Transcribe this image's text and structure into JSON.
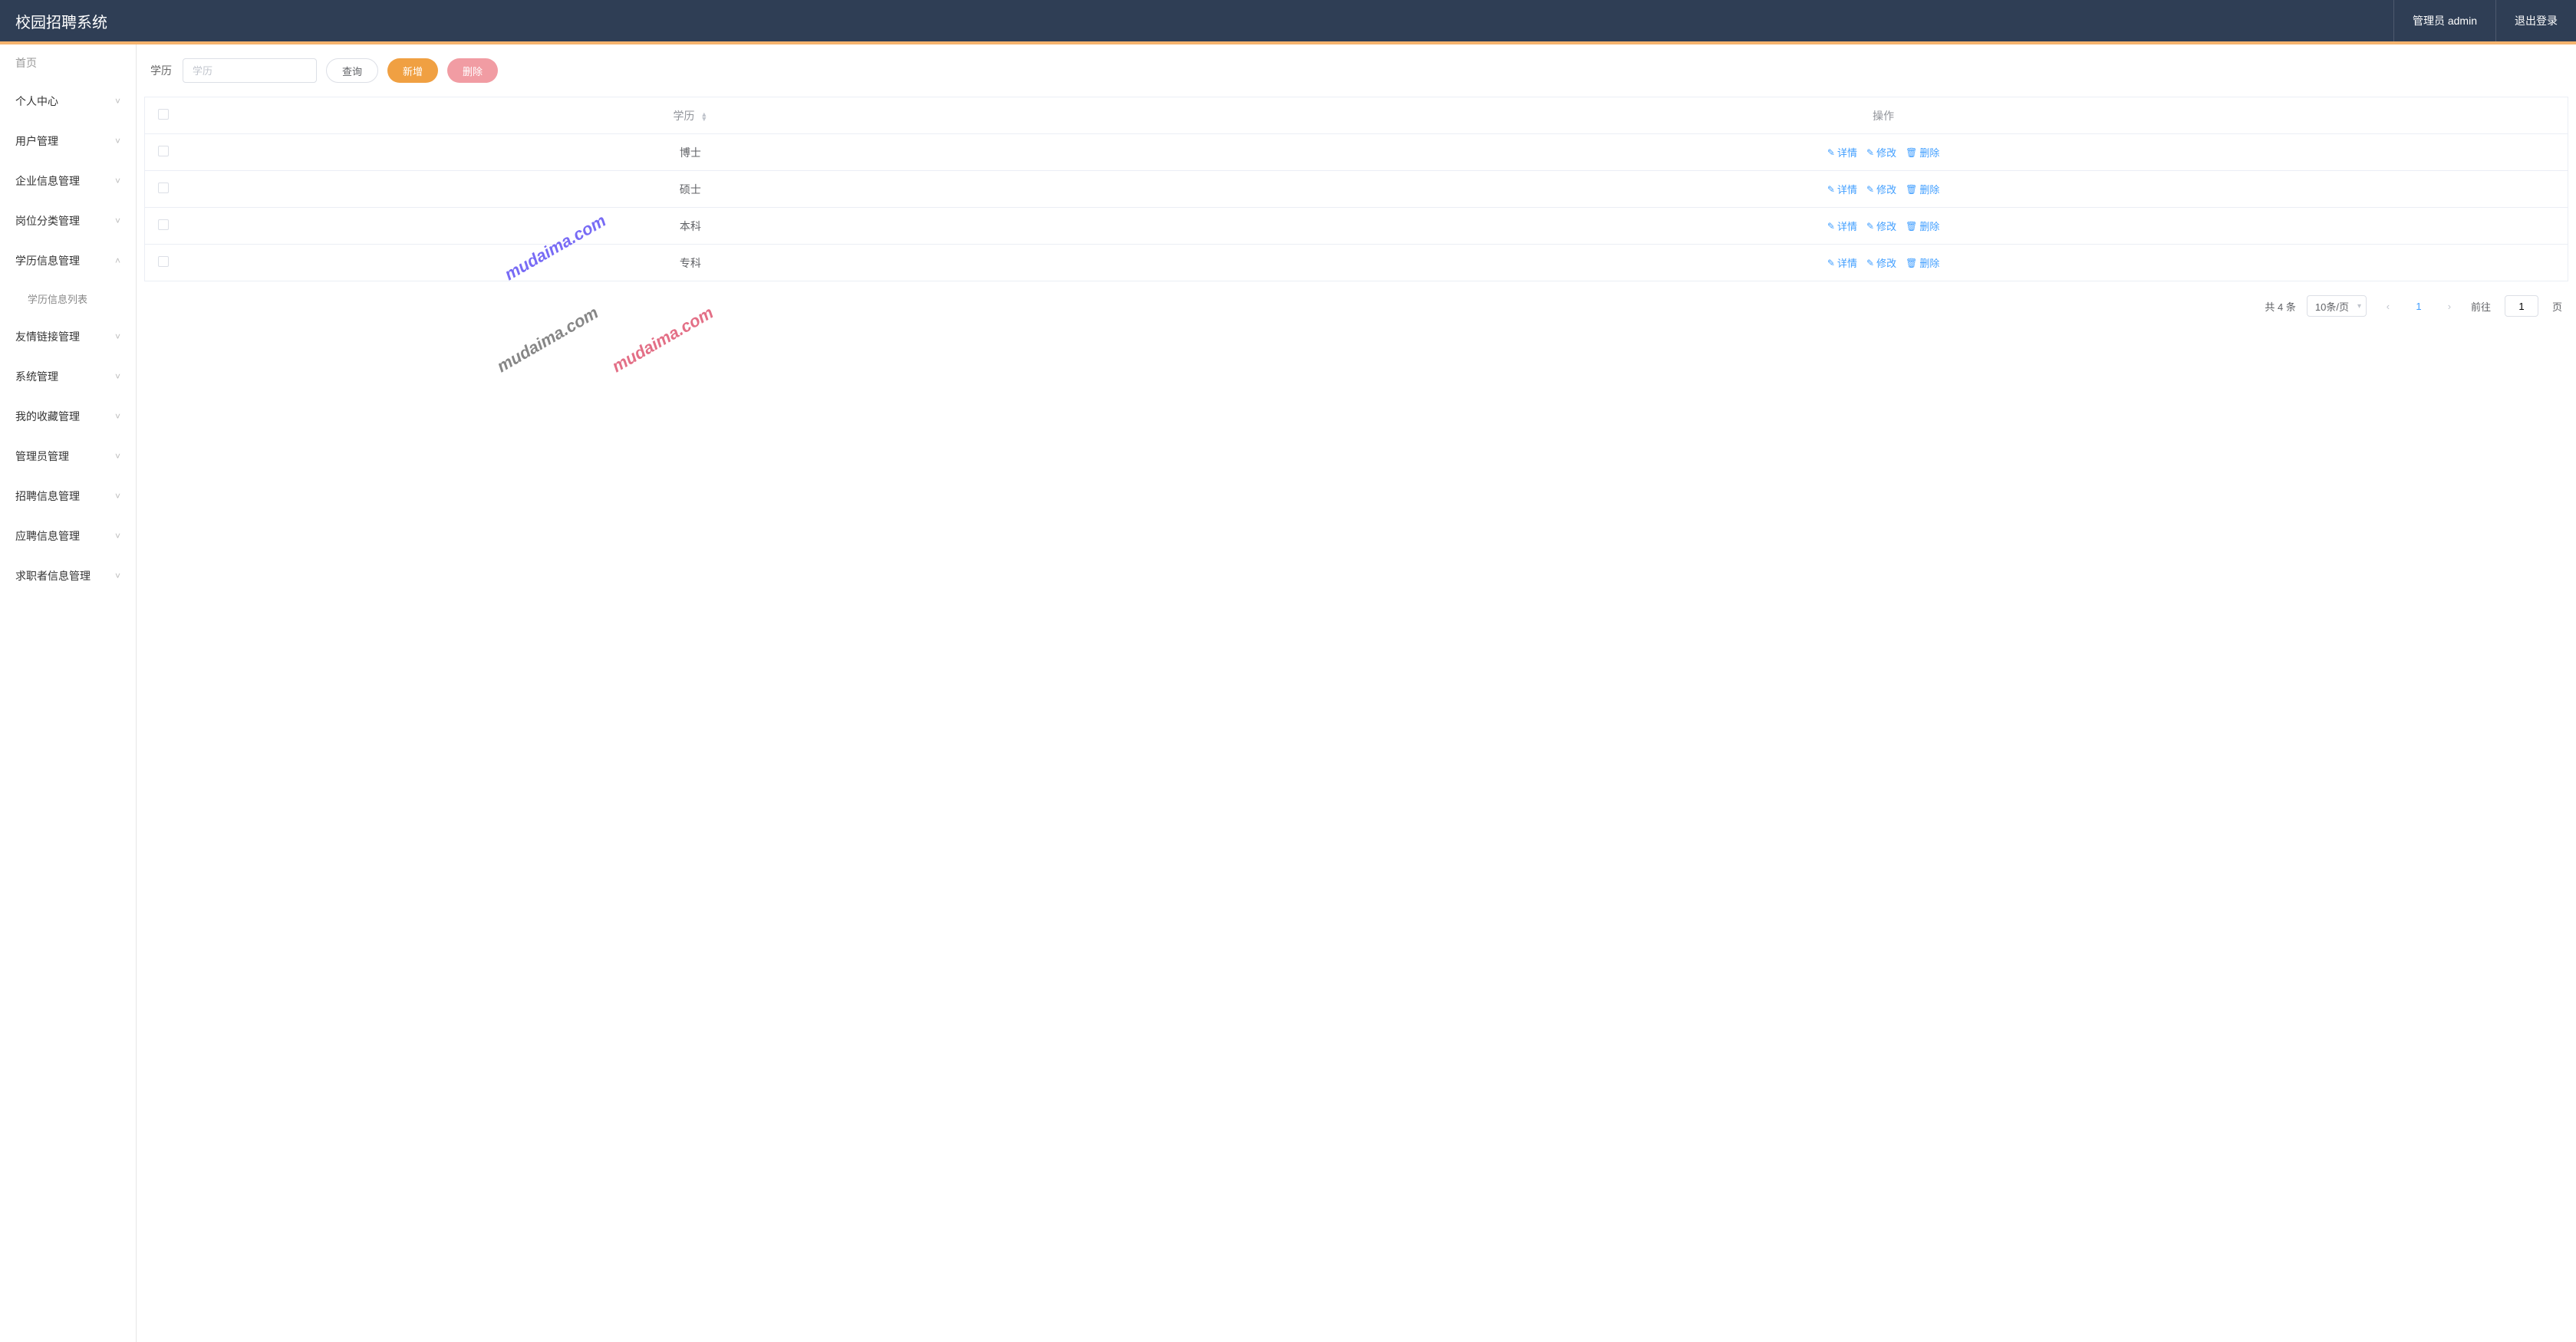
{
  "header": {
    "title": "校园招聘系统",
    "admin_label": "管理员 admin",
    "logout_label": "退出登录"
  },
  "sidebar": {
    "home": "首页",
    "items": [
      {
        "label": "个人中心",
        "expanded": false
      },
      {
        "label": "用户管理",
        "expanded": false
      },
      {
        "label": "企业信息管理",
        "expanded": false
      },
      {
        "label": "岗位分类管理",
        "expanded": false
      },
      {
        "label": "学历信息管理",
        "expanded": true,
        "sub": [
          {
            "label": "学历信息列表"
          }
        ]
      },
      {
        "label": "友情链接管理",
        "expanded": false
      },
      {
        "label": "系统管理",
        "expanded": false
      },
      {
        "label": "我的收藏管理",
        "expanded": false
      },
      {
        "label": "管理员管理",
        "expanded": false
      },
      {
        "label": "招聘信息管理",
        "expanded": false
      },
      {
        "label": "应聘信息管理",
        "expanded": false
      },
      {
        "label": "求职者信息管理",
        "expanded": false
      }
    ]
  },
  "filter": {
    "label": "学历",
    "placeholder": "学历",
    "value": "",
    "query_btn": "查询",
    "add_btn": "新增",
    "delete_btn": "删除"
  },
  "table": {
    "cols": {
      "xl": "学历",
      "ops": "操作"
    },
    "actions": {
      "detail": "详情",
      "edit": "修改",
      "delete": "删除"
    },
    "rows": [
      {
        "xl": "博士"
      },
      {
        "xl": "硕士"
      },
      {
        "xl": "本科"
      },
      {
        "xl": "专科"
      }
    ]
  },
  "pagination": {
    "total_text": "共 4 条",
    "page_size_label": "10条/页",
    "current_page": "1",
    "goto_prefix": "前往",
    "goto_suffix": "页",
    "goto_value": "1"
  },
  "watermark": "mudaima.com"
}
